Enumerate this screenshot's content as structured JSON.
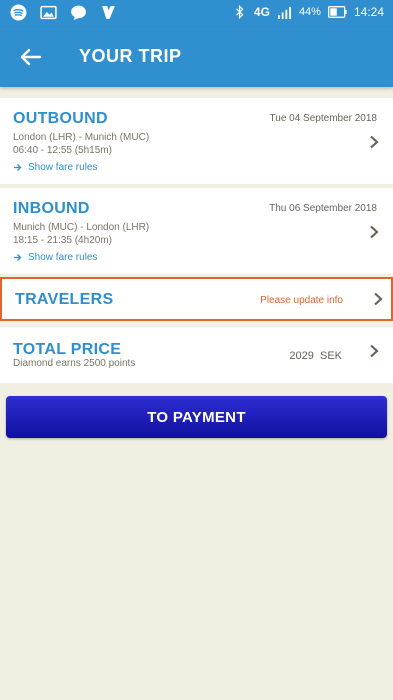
{
  "status_bar": {
    "network": "4G",
    "battery": "44%",
    "time": "14:24",
    "icons": [
      "spotify-icon",
      "gallery-icon",
      "chat-icon",
      "app-check-icon",
      "bluetooth-icon",
      "signal-icon",
      "battery-icon"
    ]
  },
  "header": {
    "title": "YOUR TRIP",
    "back_icon": "arrow-left-icon"
  },
  "outbound": {
    "title": "OUTBOUND",
    "date": "Tue 04 September 2018",
    "route": "London (LHR) - Munich (MUC)",
    "times": "06:40 - 12:55 (5h15m)",
    "fare_rules": "Show fare rules"
  },
  "inbound": {
    "title": "INBOUND",
    "date": "Thu 06 September 2018",
    "route": "Munich (MUC) - London (LHR)",
    "times": "18:15 - 21:35 (4h20m)",
    "fare_rules": "Show fare rules"
  },
  "travelers": {
    "title": "TRAVELERS",
    "status": "Please update info"
  },
  "total": {
    "title": "TOTAL PRICE",
    "points": "Diamond earns 2500 points",
    "price": "2029  SEK"
  },
  "payment_button": "TO PAYMENT",
  "colors": {
    "primary": "#2f8fcf",
    "accent_title": "#2e8fce",
    "warning": "#e2632c",
    "button": "#1a1ab8",
    "background": "#f1eee2"
  }
}
